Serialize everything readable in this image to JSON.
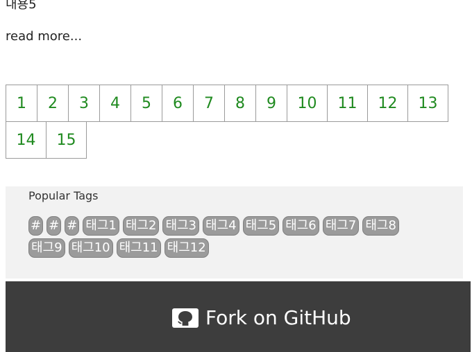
{
  "post": {
    "cut_text": "내용5",
    "read_more": "read more..."
  },
  "pagination": {
    "row1": [
      "1",
      "2",
      "3",
      "4",
      "5",
      "6",
      "7",
      "8",
      "9",
      "10",
      "11",
      "12",
      "13"
    ],
    "row2": [
      "14",
      "15"
    ]
  },
  "tags": {
    "title": "Popular Tags",
    "items": [
      "#",
      "#",
      "#",
      "태그1",
      "태그2",
      "태그3",
      "태그4",
      "태그5",
      "태그6",
      "태그7",
      "태그8",
      "태그9",
      "태그10",
      "태그11",
      "태그12"
    ]
  },
  "footer": {
    "fork_label": "Fork on GitHub",
    "icon": "github-icon"
  },
  "colors": {
    "page_link": "#1f8a1f",
    "tag_bg": "#9b9b9b",
    "footer_bg": "#3d3d3d",
    "tags_panel_bg": "#f2f2f2"
  }
}
